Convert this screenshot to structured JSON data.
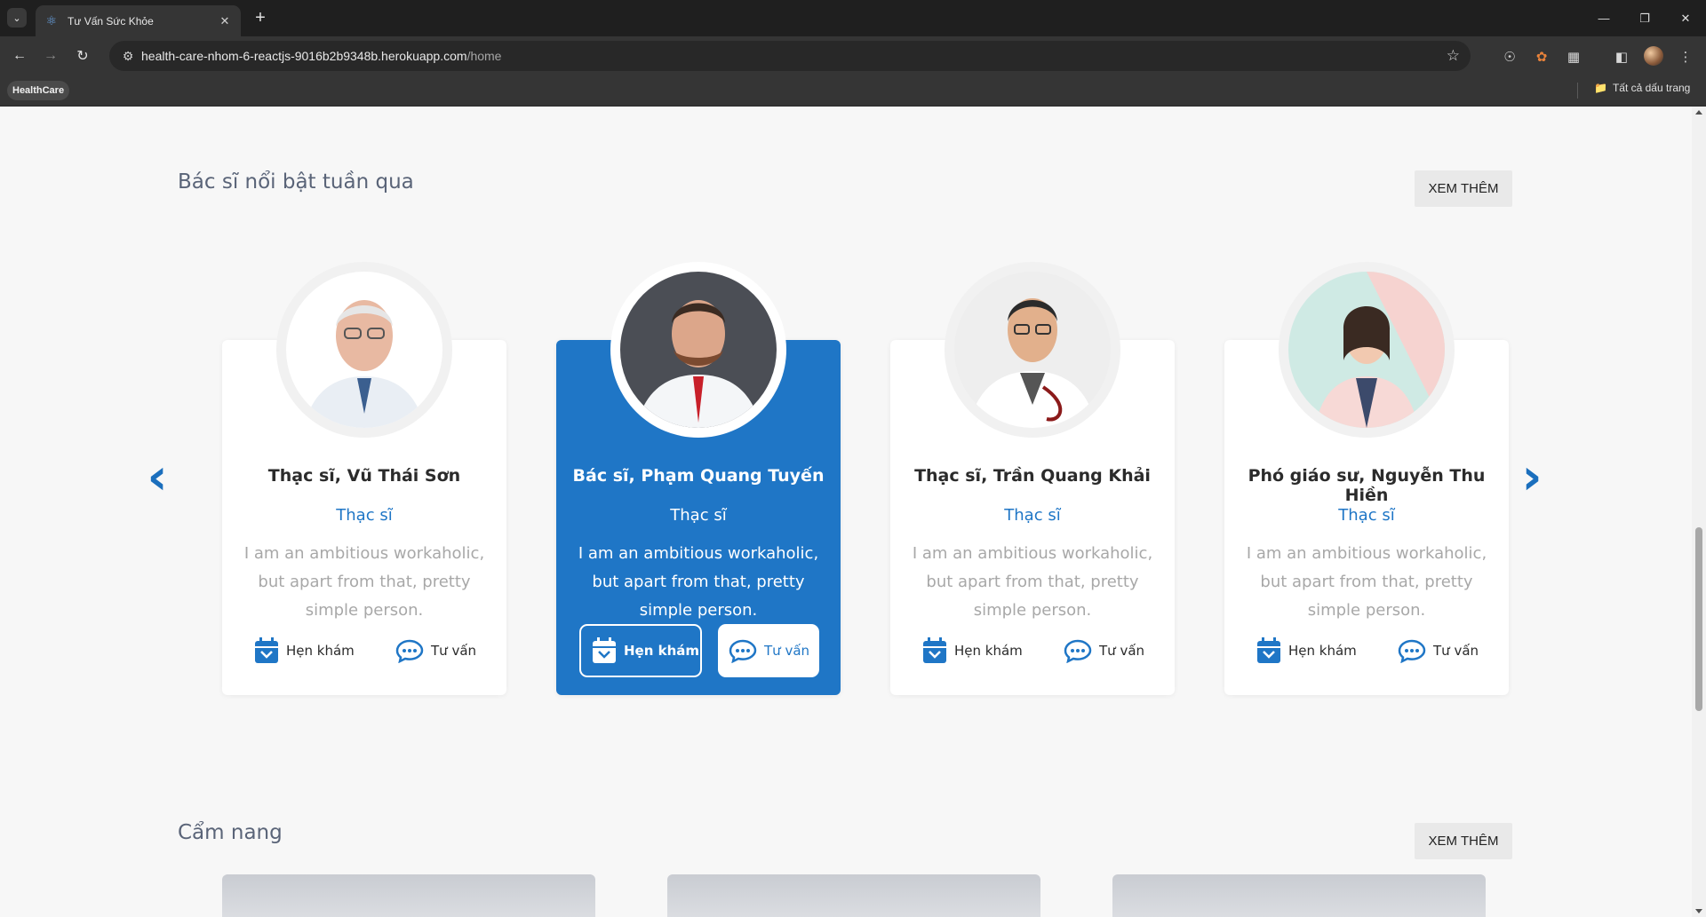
{
  "browser": {
    "tab_title": "Tư Vấn Sức Khỏe",
    "url_host": "health-care-nhom-6-reactjs-9016b2b9348b.herokuapp.com",
    "url_path": "/home",
    "bookmark": "HealthCare",
    "all_bookmarks": "Tất cả dấu trang"
  },
  "featured": {
    "title": "Bác sĩ nổi bật tuần qua",
    "more_label": "XEM THÊM",
    "doctors": [
      {
        "name": "Thạc sĩ, Vũ Thái Sơn",
        "title": "Thạc sĩ",
        "desc": "I am an ambitious workaholic, but apart from that, pretty simple person.",
        "book": "Hẹn khám",
        "consult": "Tư vấn"
      },
      {
        "name": "Bác sĩ, Phạm Quang Tuyến",
        "title": "Thạc sĩ",
        "desc": "I am an ambitious workaholic, but apart from that, pretty simple person.",
        "book": "Hẹn khám",
        "consult": "Tư vấn"
      },
      {
        "name": "Thạc sĩ, Trần Quang Khải",
        "title": "Thạc sĩ",
        "desc": "I am an ambitious workaholic, but apart from that, pretty simple person.",
        "book": "Hẹn khám",
        "consult": "Tư vấn"
      },
      {
        "name": "Phó giáo sư, Nguyễn Thu Hiền",
        "title": "Thạc sĩ",
        "desc": "I am an ambitious workaholic, but apart from that, pretty simple person.",
        "book": "Hẹn khám",
        "consult": "Tư vấn"
      }
    ]
  },
  "handbook": {
    "title": "Cẩm nang",
    "more_label": "XEM THÊM"
  },
  "colors": {
    "accent": "#1f76c6",
    "page_bg": "#f7f7f7",
    "card_bg": "#ffffff"
  },
  "icons": {
    "prev": "chevron-left-icon",
    "next": "chevron-right-icon",
    "book": "calendar-icon",
    "consult": "chat-bubble-icon"
  }
}
